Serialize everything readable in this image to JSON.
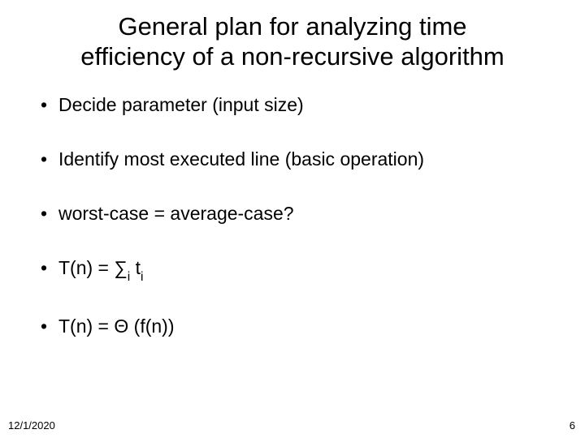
{
  "title_line1": "General plan for analyzing time",
  "title_line2": "efficiency of a non-recursive algorithm",
  "bullets": {
    "b0": "Decide parameter (input size)",
    "b1": "Identify most executed line (basic operation)",
    "b2": "worst-case = average-case?",
    "b3_prefix": "T(n) = ",
    "b3_sigma": "∑",
    "b3_sub1": "i",
    "b3_mid": " t",
    "b3_sub2": "i",
    "b4_prefix": "T(n) = ",
    "b4_theta": "Θ",
    "b4_suffix": " (f(n))"
  },
  "footer": {
    "date": "12/1/2020",
    "page": "6"
  },
  "bullet_glyph": "•"
}
